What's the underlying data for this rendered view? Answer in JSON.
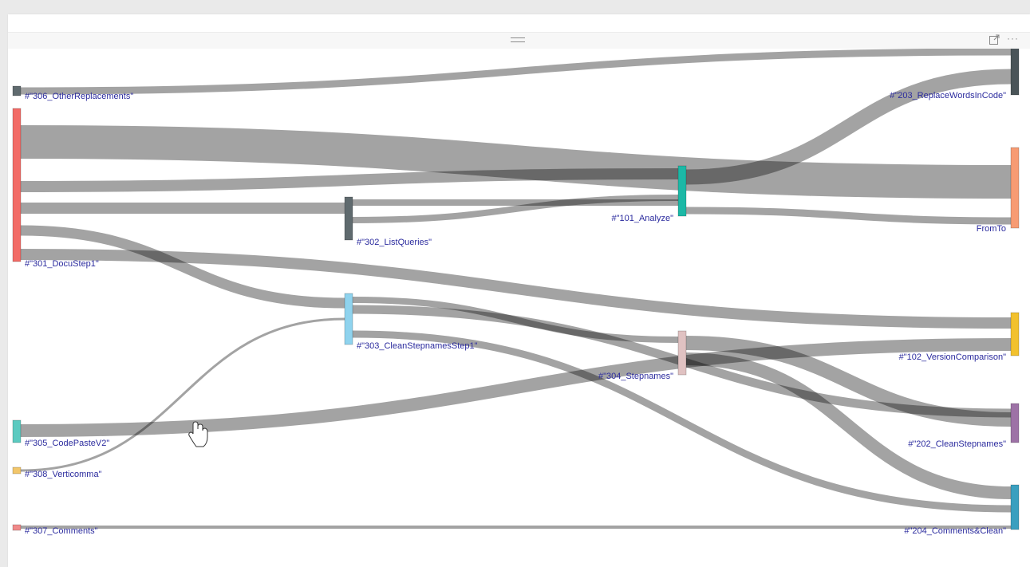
{
  "visual_header": {
    "more_options": "···"
  },
  "nodes": [
    {
      "id": "n306",
      "label": "#\"306_OtherReplacements\"",
      "color": "#5f6a6e"
    },
    {
      "id": "n301",
      "label": "#\"301_DocuStep1\"",
      "color": "#f26b66"
    },
    {
      "id": "n305",
      "label": "#\"305_CodePasteV2\"",
      "color": "#5ccac0"
    },
    {
      "id": "n308",
      "label": "#\"308_Verticomma\"",
      "color": "#f2c66a"
    },
    {
      "id": "n307",
      "label": "#\"307_Comments\"",
      "color": "#f08a8a"
    },
    {
      "id": "n302",
      "label": "#\"302_ListQueries\"",
      "color": "#5f6a6e"
    },
    {
      "id": "n303",
      "label": "#\"303_CleanStepnamesStep1\"",
      "color": "#8fd3ee"
    },
    {
      "id": "n101",
      "label": "#\"101_Analyze\"",
      "color": "#1cb8a6"
    },
    {
      "id": "n304",
      "label": "#\"304_Stepnames\"",
      "color": "#e0c2c2"
    },
    {
      "id": "n203",
      "label": "#\"203_ReplaceWordsInCode\"",
      "color": "#4a5458"
    },
    {
      "id": "nFromTo",
      "label": "FromTo",
      "color": "#f79b73"
    },
    {
      "id": "n102",
      "label": "#\"102_VersionComparison\"",
      "color": "#f2c12e"
    },
    {
      "id": "n202",
      "label": "#\"202_CleanStepnames\"",
      "color": "#9d72a6"
    },
    {
      "id": "n204",
      "label": "#\"204_Comments&Clean\"",
      "color": "#3a9fbf"
    }
  ],
  "links": [
    {
      "source": "n306",
      "target": "n203"
    },
    {
      "source": "n301",
      "target": "nFromTo"
    },
    {
      "source": "n301",
      "target": "n101"
    },
    {
      "source": "n301",
      "target": "n302"
    },
    {
      "source": "n301",
      "target": "n303"
    },
    {
      "source": "n301",
      "target": "n102"
    },
    {
      "source": "n302",
      "target": "n101"
    },
    {
      "source": "n302",
      "target": "n101"
    },
    {
      "source": "n101",
      "target": "n203"
    },
    {
      "source": "n101",
      "target": "nFromTo"
    },
    {
      "source": "n303",
      "target": "n304"
    },
    {
      "source": "n303",
      "target": "n202"
    },
    {
      "source": "n303",
      "target": "n204"
    },
    {
      "source": "n304",
      "target": "n202"
    },
    {
      "source": "n304",
      "target": "n204"
    },
    {
      "source": "n305",
      "target": "n102"
    },
    {
      "source": "n308",
      "target": "n303"
    },
    {
      "source": "n307",
      "target": "n204"
    }
  ]
}
